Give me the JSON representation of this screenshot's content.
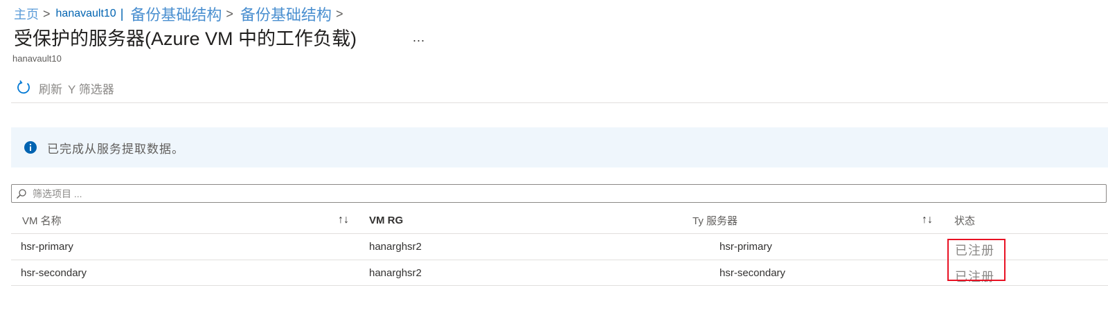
{
  "breadcrumb": {
    "home": "主页",
    "sep": ">",
    "vault": "hanavault10",
    "vault_bar": "|",
    "item1": "备份基础结构",
    "item2": "备份基础结构"
  },
  "page": {
    "title": "受保护的服务器(Azure VM 中的工作负载)",
    "more": "...",
    "subtitle": "hanavault10"
  },
  "toolbar": {
    "refresh_label": "刷新",
    "filter_label": "Y 筛选器"
  },
  "info": {
    "message": "已完成从服务提取数据。"
  },
  "search": {
    "placeholder": "筛选项目 ..."
  },
  "table": {
    "columns": [
      "VM 名称",
      "VM RG",
      "Ty 服务器",
      "状态"
    ],
    "sort_glyph": "↑↓",
    "rows": [
      [
        "hsr-primary",
        "hanarghsr2",
        "hsr-primary",
        "已注册"
      ],
      [
        "hsr-secondary",
        "hanarghsr2",
        "hsr-secondary",
        "已注册"
      ]
    ]
  },
  "colors": {
    "accent": "#0078d4",
    "info_bg": "#eff6fc",
    "highlight": "#e81123"
  }
}
